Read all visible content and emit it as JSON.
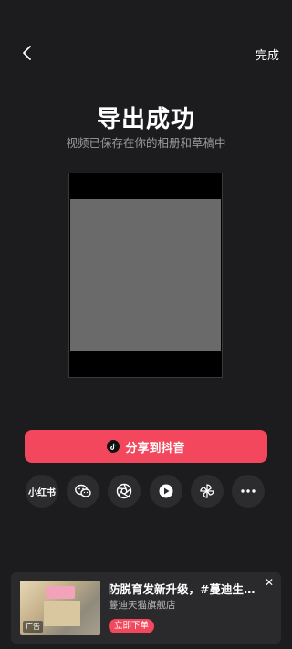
{
  "header": {
    "done_label": "完成",
    "back_icon": "chevron-left-icon"
  },
  "main": {
    "title": "导出成功",
    "subtitle": "视频已保存在你的相册和草稿中"
  },
  "share": {
    "button_label": "分享到抖音",
    "button_color": "#f2475d",
    "targets": [
      {
        "name": "xiaohongshu",
        "label": "小红书"
      },
      {
        "name": "wechat",
        "icon": "wechat-icon"
      },
      {
        "name": "moments",
        "icon": "shutter-icon"
      },
      {
        "name": "douyin-play",
        "icon": "play-circle-icon"
      },
      {
        "name": "link-share",
        "icon": "pinwheel-icon"
      },
      {
        "name": "more",
        "icon": "more-dots-icon"
      }
    ]
  },
  "ad": {
    "title": "防脱育发新升级，#蔓迪生发液#",
    "shop": "蔓迪天猫旗舰店",
    "cta": "立即下单",
    "tag": "广告",
    "close": "✕"
  }
}
